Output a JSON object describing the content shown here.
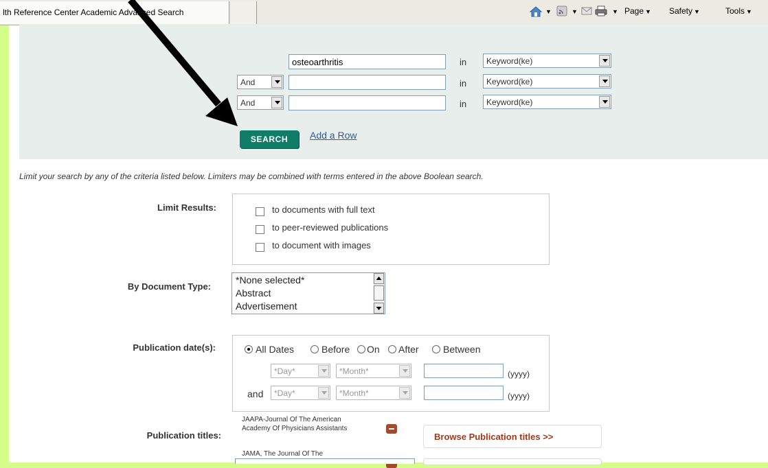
{
  "browser": {
    "tab_title": "lth Reference Center Academic Advanced Search",
    "commands": {
      "page": "Page",
      "safety": "Safety",
      "tools": "Tools"
    }
  },
  "search": {
    "rows": [
      {
        "operator": "",
        "term": "osteoarthritis",
        "in_label": "in",
        "field": "Keyword(ke)"
      },
      {
        "operator": "And",
        "term": "",
        "in_label": "in",
        "field": "Keyword(ke)"
      },
      {
        "operator": "And",
        "term": "",
        "in_label": "in",
        "field": "Keyword(ke)"
      }
    ],
    "search_button": "SEARCH",
    "add_row": "Add a Row"
  },
  "limiters": {
    "intro": "Limit your search by any of the criteria listed below. Limiters may be combined with terms entered in the above Boolean search.",
    "limit_results": {
      "label": "Limit Results:",
      "options": [
        "to documents with full text",
        "to peer-reviewed publications",
        "to document with images"
      ]
    },
    "document_type": {
      "label": "By Document Type:",
      "options": [
        "*None selected*",
        "Abstract",
        "Advertisement"
      ]
    },
    "publication_date": {
      "label": "Publication date(s):",
      "options": [
        "All Dates",
        "Before",
        "On",
        "After",
        "Between"
      ],
      "selected": "All Dates",
      "day_placeholder": "*Day*",
      "month_placeholder": "*Month*",
      "year_hint": "(yyyy)",
      "and_label": "and"
    },
    "publication_titles": {
      "label": "Publication titles:",
      "items": [
        "JAAPA-Journal Of The American Academy Of Physicians Assistants",
        "JAMA, The Journal Of The"
      ],
      "browse_button": "Browse Publication titles >>"
    }
  },
  "colors": {
    "frame": "#d4fd8a",
    "panel": "#e7eeec",
    "search_button": "#0f7d68",
    "link": "#315a98",
    "browse": "#a0391c",
    "remove_icon": "#a34a2a"
  },
  "annotation": {
    "arrow": "black-arrow pointing to SEARCH button"
  }
}
